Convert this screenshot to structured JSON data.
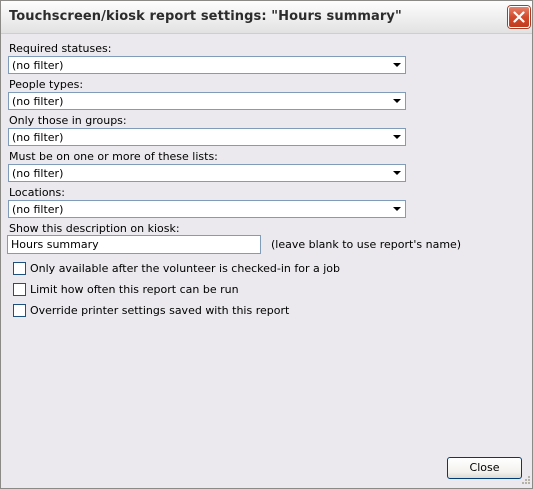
{
  "window": {
    "title": "Touchscreen/kiosk report settings: \"Hours summary\""
  },
  "fields": [
    {
      "label": "Required statuses:",
      "value": "(no filter)"
    },
    {
      "label": "People types:",
      "value": "(no filter)"
    },
    {
      "label": "Only those in groups:",
      "value": "(no filter)"
    },
    {
      "label": "Must be on one or more of these lists:",
      "value": "(no filter)"
    },
    {
      "label": "Locations:",
      "value": "(no filter)"
    }
  ],
  "description": {
    "label": "Show this description on kiosk:",
    "value": "Hours summary",
    "hint": "(leave blank to use report's name)"
  },
  "checkboxes": [
    {
      "label": "Only available after the volunteer is checked-in for a job",
      "checked": false
    },
    {
      "label": "Limit how often this report can be run",
      "checked": false
    },
    {
      "label": "Override printer settings saved with this report",
      "checked": false
    }
  ],
  "buttons": {
    "close": "Close"
  },
  "colors": {
    "close_x": "#d24a2c",
    "field_border": "#7f9db9",
    "dialog_bg": "#ebe9ed"
  },
  "icons": {
    "title_close": "close-icon",
    "dropdown": "chevron-down-icon",
    "resize": "resize-grip-icon"
  }
}
